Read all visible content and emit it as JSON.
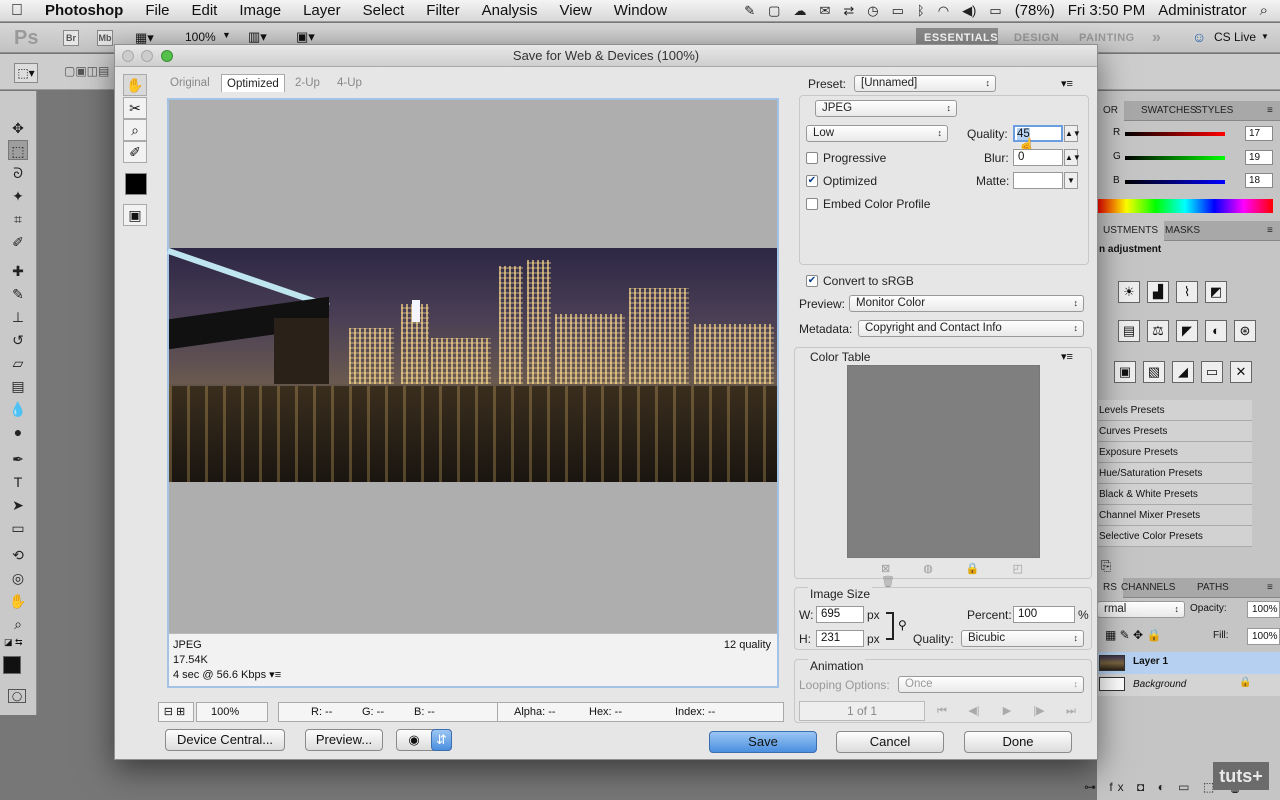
{
  "menubar": {
    "apple_glyph": "",
    "app": "Photoshop",
    "items": [
      "File",
      "Edit",
      "Image",
      "Layer",
      "Select",
      "Filter",
      "Analysis",
      "View",
      "Window"
    ],
    "battery": "(78%)",
    "clock": "Fri 3:50 PM",
    "user": "Administrator"
  },
  "appbar": {
    "logo": "Ps",
    "br": "Br",
    "mb": "Mb",
    "zoom": "100%",
    "workspaces": [
      "ESSENTIALS",
      "DESIGN",
      "PAINTING"
    ],
    "active_workspace": "ESSENTIALS",
    "more": "»",
    "cslive": "CS Live"
  },
  "panels": {
    "color_tabs": [
      "OR",
      "SWATCHES",
      "STYLES"
    ],
    "color": {
      "r_label": "R",
      "g_label": "G",
      "b_label": "B",
      "r": "17",
      "g": "19",
      "b": "18"
    },
    "adjust_tabs": [
      "USTMENTS",
      "MASKS"
    ],
    "adjust_heading": "n adjustment",
    "presets": [
      "Levels Presets",
      "Curves Presets",
      "Exposure Presets",
      "Hue/Saturation Presets",
      "Black & White Presets",
      "Channel Mixer Presets",
      "Selective Color Presets"
    ],
    "layers_tabs": [
      "RS",
      "CHANNELS",
      "PATHS"
    ],
    "blend": "rmal",
    "opacity_label": "Opacity:",
    "opacity": "100%",
    "fill_label": "Fill:",
    "fill": "100%",
    "layers": [
      "Layer 1",
      "Background"
    ]
  },
  "dialog": {
    "title": "Save for Web & Devices (100%)",
    "view_tabs": [
      "Original",
      "Optimized",
      "2-Up",
      "4-Up"
    ],
    "active_tab": "Optimized",
    "preview_info": {
      "format": "JPEG",
      "size": "17.54K",
      "time": "4 sec @ 56.6 Kbps",
      "quality": "12 quality"
    },
    "status": {
      "zoom": "100%",
      "r": "R: --",
      "g": "G: --",
      "b": "B: --",
      "alpha": "Alpha: --",
      "hex": "Hex: --",
      "index": "Index: --"
    },
    "buttons": {
      "device_central": "Device Central...",
      "preview": "Preview...",
      "save": "Save",
      "cancel": "Cancel",
      "done": "Done"
    },
    "settings": {
      "preset_label": "Preset:",
      "preset": "[Unnamed]",
      "format": "JPEG",
      "quality_level": "Low",
      "quality_label": "Quality:",
      "quality": "45",
      "progressive": "Progressive",
      "progressive_checked": false,
      "blur_label": "Blur:",
      "blur": "0",
      "optimized": "Optimized",
      "optimized_checked": true,
      "matte_label": "Matte:",
      "embed_profile": "Embed Color Profile",
      "embed_checked": false,
      "convert_srgb": "Convert to sRGB",
      "convert_checked": true,
      "preview_label": "Preview:",
      "preview_value": "Monitor Color",
      "metadata_label": "Metadata:",
      "metadata_value": "Copyright and Contact Info",
      "color_table": "Color Table",
      "image_size": "Image Size",
      "w_label": "W:",
      "w": "695",
      "h_label": "H:",
      "h": "231",
      "px": "px",
      "percent_label": "Percent:",
      "percent": "100",
      "percent_unit": "%",
      "resample_label": "Quality:",
      "resample": "Bicubic",
      "animation": "Animation",
      "looping_label": "Looping Options:",
      "looping": "Once",
      "frame": "1 of 1"
    }
  },
  "watermark": "tuts+"
}
